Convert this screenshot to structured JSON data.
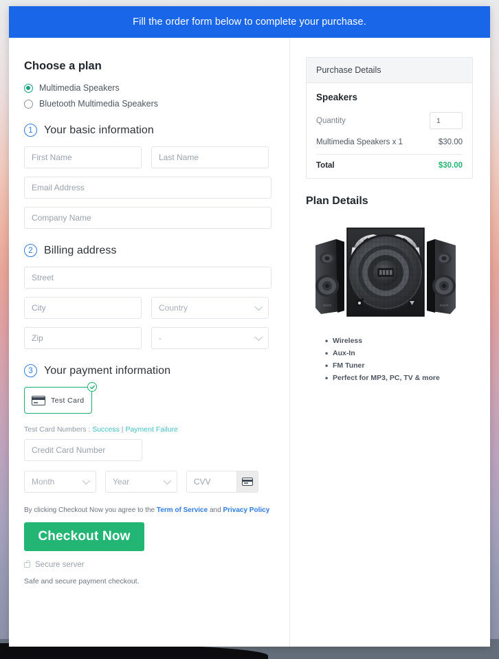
{
  "banner": {
    "text": "Fill the order form below to complete your purchase."
  },
  "plan": {
    "heading": "Choose a plan",
    "options": [
      {
        "label": "Multimedia Speakers",
        "selected": true
      },
      {
        "label": "Bluetooth Multimedia Speakers",
        "selected": false
      }
    ]
  },
  "steps": {
    "basic": {
      "number": "1",
      "label": "Your basic information"
    },
    "billing": {
      "number": "2",
      "label": "Billing address"
    },
    "payment": {
      "number": "3",
      "label": "Your payment information"
    }
  },
  "fields": {
    "first_name": {
      "placeholder": "First Name",
      "value": ""
    },
    "last_name": {
      "placeholder": "Last Name",
      "value": ""
    },
    "email": {
      "placeholder": "Email Address",
      "value": ""
    },
    "company": {
      "placeholder": "Company Name",
      "value": ""
    },
    "street": {
      "placeholder": "Street",
      "value": ""
    },
    "city": {
      "placeholder": "City",
      "value": ""
    },
    "country": {
      "placeholder": "Country",
      "value": ""
    },
    "zip": {
      "placeholder": "Zip",
      "value": ""
    },
    "state": {
      "placeholder": "-",
      "value": ""
    },
    "credit_card": {
      "placeholder": "Credit Card Number",
      "value": ""
    },
    "month": {
      "placeholder": "Month",
      "value": ""
    },
    "year": {
      "placeholder": "Year",
      "value": ""
    },
    "cvv": {
      "placeholder": "CVV",
      "value": ""
    }
  },
  "payment_method": {
    "tile_label": "Test  Card",
    "selected": true,
    "icon": "credit-card-icon",
    "check_icon": "check-circle-icon"
  },
  "test_cards": {
    "prefix": "Test Card Numbers : ",
    "success_link": "Success",
    "separator": " | ",
    "failure_link": "Payment Failure"
  },
  "agreement": {
    "prefix": "By clicking Checkout Now you agree to the ",
    "terms_link": "Term of Service",
    "middle": " and ",
    "privacy_link": "Privacy Policy"
  },
  "checkout": {
    "label": "Checkout Now"
  },
  "secure": {
    "icon": "lock-icon",
    "label": "Secure server"
  },
  "safe_note": "Safe and secure payment checkout.",
  "purchase_details": {
    "header": "Purchase Details",
    "product_title": "Speakers",
    "quantity_label": "Quantity",
    "quantity_value": "1",
    "line_item_label": "Multimedia Speakers x 1",
    "line_item_amount": "$30.00",
    "total_label": "Total",
    "total_amount": "$30.00"
  },
  "plan_details": {
    "title": "Plan Details",
    "image_alt": "multimedia-speakers-product-image",
    "features": [
      "Wireless",
      "Aux-In",
      "FM Tuner",
      "Perfect for MP3, PC, TV & more"
    ]
  },
  "colors": {
    "banner_blue": "#1a66e8",
    "accent_green": "#22b573",
    "tile_green": "#19b36b",
    "radio_green": "#16a085",
    "link_teal": "#3fbfc4",
    "link_blue": "#2f7be0",
    "step_blue": "#2f7be0"
  }
}
